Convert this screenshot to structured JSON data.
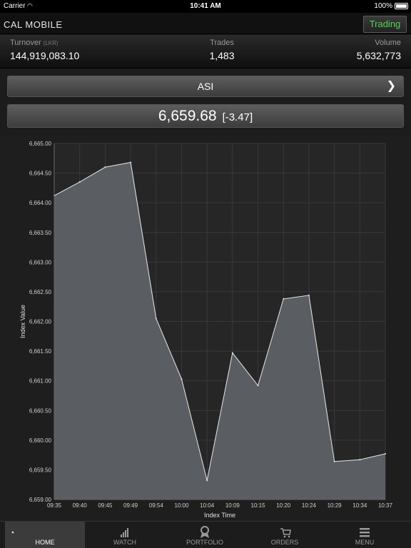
{
  "status_bar": {
    "carrier": "Carrier",
    "time": "10:41 AM",
    "battery": "100%"
  },
  "header": {
    "title": "CAL MOBILE",
    "trading_button": "Trading",
    "trading_color": "#4fd34f"
  },
  "stats": {
    "turnover_label": "Turnover",
    "turnover_unit": "(LKR)",
    "turnover_value": "144,919,083.10",
    "trades_label": "Trades",
    "trades_value": "1,483",
    "volume_label": "Volume",
    "volume_value": "5,632,773"
  },
  "index_selector": {
    "label": "ASI"
  },
  "index_value": {
    "value": "6,659.68",
    "change": "[-3.47]"
  },
  "chart_data": {
    "type": "area",
    "xlabel": "Index Time",
    "ylabel": "Index Value",
    "x": [
      "09:35",
      "09:40",
      "09:45",
      "09:49",
      "09:54",
      "10:00",
      "10:04",
      "10:09",
      "10:15",
      "10:20",
      "10:24",
      "10:29",
      "10:34",
      "10:37"
    ],
    "values": [
      6664.12,
      6664.35,
      6664.6,
      6664.68,
      6662.05,
      6661.03,
      6659.32,
      6661.47,
      6660.92,
      6662.38,
      6662.44,
      6659.64,
      6659.67,
      6659.77
    ],
    "ylim": [
      6659.0,
      6665.0
    ],
    "y_ticks": [
      "6,659.00",
      "6,659.50",
      "6,660.00",
      "6,660.50",
      "6,661.00",
      "6,661.50",
      "6,662.00",
      "6,662.50",
      "6,663.00",
      "6,663.50",
      "6,664.00",
      "6,664.50",
      "6,665.00"
    ],
    "grid": true,
    "fill_color": "#5d6166",
    "line_color": "#e8e8e8"
  },
  "tabs": [
    {
      "label": "HOME",
      "icon": "home-icon",
      "active": true
    },
    {
      "label": "WATCH",
      "icon": "bar-chart-icon",
      "active": false
    },
    {
      "label": "PORTFOLIO",
      "icon": "ribbon-icon",
      "active": false
    },
    {
      "label": "ORDERS",
      "icon": "cart-icon",
      "active": false
    },
    {
      "label": "MENU",
      "icon": "menu-icon",
      "active": false
    }
  ]
}
